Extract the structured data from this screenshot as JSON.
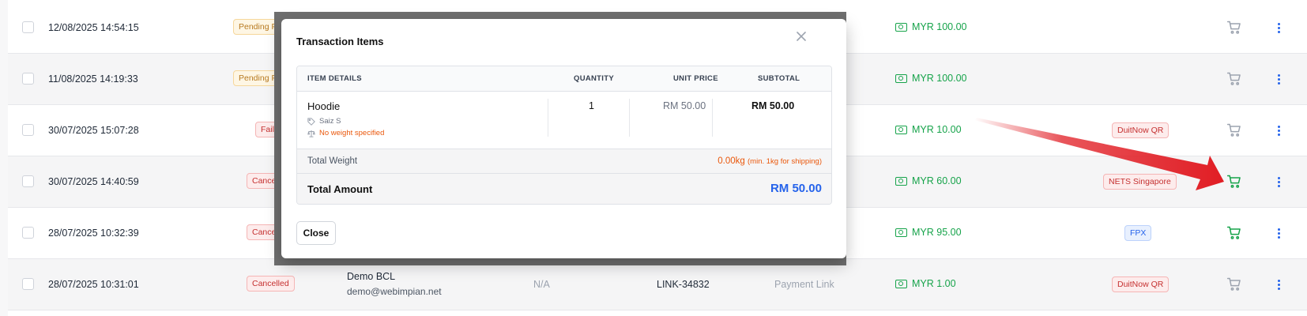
{
  "rows": [
    {
      "date": "12/08/2025 14:54:15",
      "status": "Pending P",
      "amount": "MYR 100.00",
      "method": ""
    },
    {
      "date": "11/08/2025 14:19:33",
      "status": "Pending P",
      "amount": "MYR 100.00",
      "method": ""
    },
    {
      "date": "30/07/2025 15:07:28",
      "status": "Faile",
      "amount": "MYR 10.00",
      "method": "DuitNow QR"
    },
    {
      "date": "30/07/2025 14:40:59",
      "status": "Cance",
      "amount": "MYR 60.00",
      "method": "NETS Singapore"
    },
    {
      "date": "28/07/2025 10:32:39",
      "status": "Cance",
      "amount": "MYR 95.00",
      "method": "FPX"
    },
    {
      "date": "28/07/2025 10:31:01",
      "status": "Cancelled",
      "customer_name": "Demo BCL",
      "customer_email": "demo@webimpian.net",
      "col_na": "N/A",
      "reference": "LINK-34832",
      "source": "Payment Link",
      "amount": "MYR 1.00",
      "method": "DuitNow QR"
    }
  ],
  "colors": {
    "cart_active": "#16a34a",
    "cart_inactive": "#9ca3af",
    "accent": "#2563eb",
    "arrow": "#e11d24"
  },
  "modal": {
    "title": "Transaction Items",
    "columns": {
      "details": "ITEM DETAILS",
      "quantity": "QUANTITY",
      "unit_price": "UNIT PRICE",
      "subtotal": "SUBTOTAL"
    },
    "item": {
      "name": "Hoodie",
      "attr": "Saiz S",
      "warning": "No weight specified",
      "quantity": "1",
      "unit_price": "RM 50.00",
      "subtotal": "RM 50.00"
    },
    "total_weight_label": "Total Weight",
    "total_weight_value": "0.00kg",
    "total_weight_note": "(min. 1kg for shipping)",
    "total_amount_label": "Total Amount",
    "total_amount_value": "RM 50.00",
    "close_label": "Close"
  }
}
